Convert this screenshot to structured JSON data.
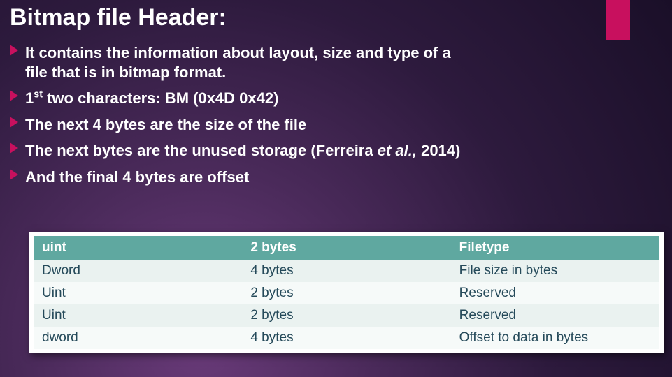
{
  "accent_color": "#c8105e",
  "title": "Bitmap file Header:",
  "bullets": [
    {
      "pre": "It contains the information about layout, size and type of a file that is in bitmap format."
    },
    {
      "pre": "1",
      "sup": "st",
      "post": " two characters: BM (0x4D 0x42)"
    },
    {
      "pre": "The next 4 bytes are the size of the file"
    },
    {
      "pre": "The next bytes are the  unused storage (Ferreira ",
      "ital": "et al.,",
      "post": " 2014)"
    },
    {
      "pre": "And the final 4 bytes are offset"
    }
  ],
  "table": {
    "headers": [
      "uint",
      "2 bytes",
      "Filetype"
    ],
    "rows": [
      [
        "Dword",
        "4 bytes",
        "File size in bytes"
      ],
      [
        "Uint",
        "2 bytes",
        "Reserved"
      ],
      [
        "Uint",
        "2 bytes",
        "Reserved"
      ],
      [
        "dword",
        "4 bytes",
        "Offset to data in bytes"
      ]
    ]
  }
}
